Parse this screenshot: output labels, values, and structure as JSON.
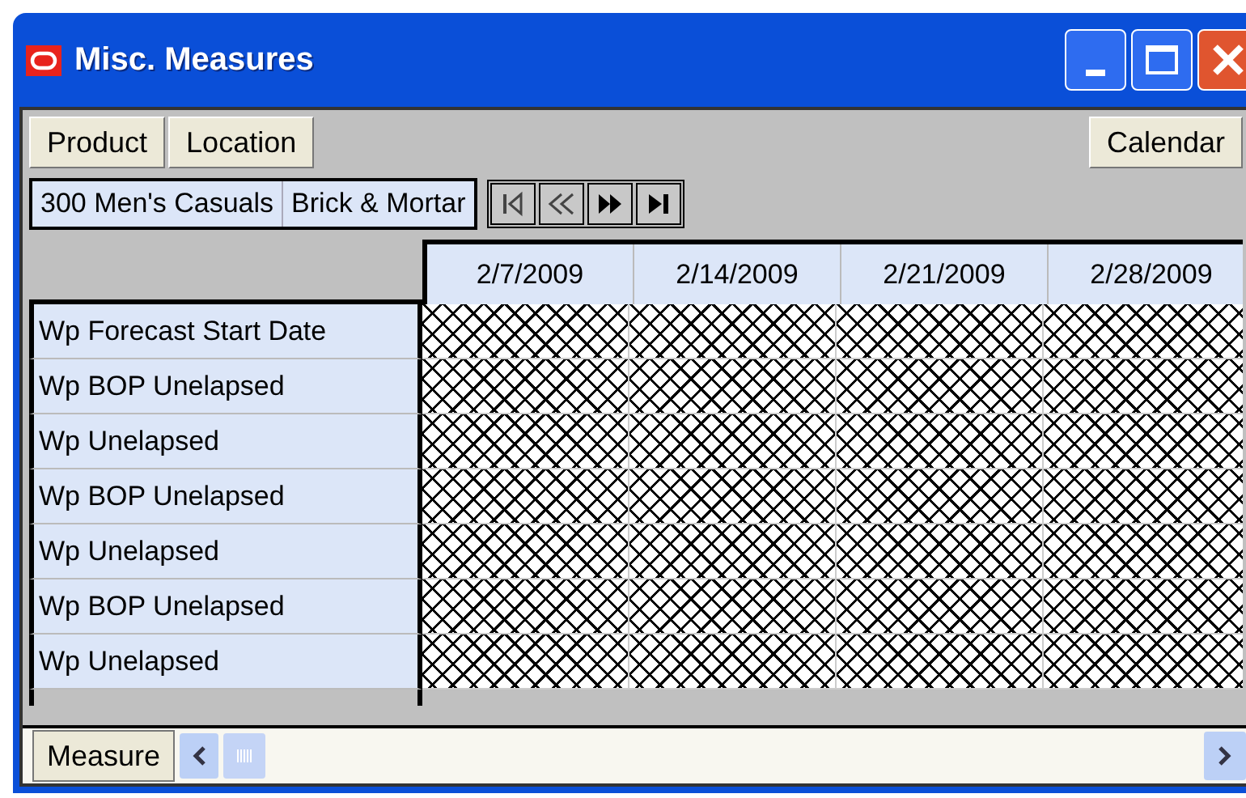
{
  "window": {
    "title": "Misc. Measures"
  },
  "dimension_buttons": [
    {
      "label": "Product"
    },
    {
      "label": "Location"
    }
  ],
  "calendar_button": {
    "label": "Calendar"
  },
  "context": [
    "300 Men's Casuals",
    "Brick & Mortar"
  ],
  "grid": {
    "columns": [
      "2/7/2009",
      "2/14/2009",
      "2/21/2009",
      "2/28/2009"
    ],
    "rows": [
      "Wp Forecast Start Date",
      "Wp BOP Unelapsed",
      "Wp Unelapsed",
      "Wp BOP Unelapsed",
      "Wp Unelapsed",
      "Wp BOP Unelapsed",
      "Wp Unelapsed"
    ]
  },
  "measure_button": {
    "label": "Measure"
  }
}
